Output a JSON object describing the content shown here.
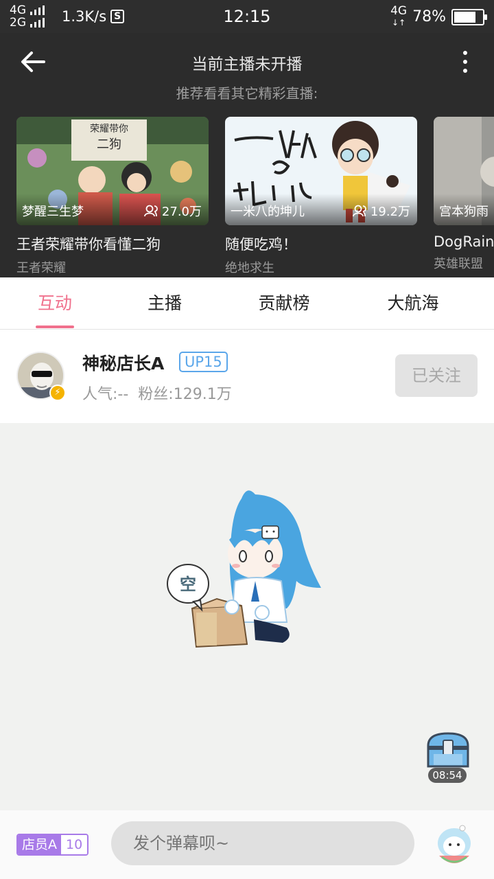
{
  "status_bar": {
    "net1": "4G",
    "net2": "2G",
    "speed": "1.3K/s",
    "s_glyph": "S",
    "time": "12:15",
    "net_right": "4G",
    "battery": "78%",
    "battery_level": 0.78
  },
  "header": {
    "title": "当前主播未开播",
    "subtitle": "推荐看看其它精彩直播:"
  },
  "recommend": [
    {
      "anchor": "梦醒三生梦",
      "viewers": "27.0万",
      "title": "王者荣耀带你看懂二狗",
      "category": "王者荣耀"
    },
    {
      "anchor": "一米八的坤儿",
      "viewers": "19.2万",
      "title": "随便吃鸡！",
      "category": "绝地求生"
    },
    {
      "anchor": "宫本狗雨",
      "viewers": "",
      "title": "DogRain",
      "category": "英雄联盟"
    }
  ],
  "tabs": [
    "互动",
    "主播",
    "贡献榜",
    "大航海"
  ],
  "anchor_info": {
    "name": "神秘店长A",
    "level": "UP15",
    "popularity": "人气:--",
    "fans": "粉丝:129.1万",
    "follow_label": "已关注"
  },
  "empty_state": {
    "bubble_text": "空",
    "chest_timer": "08:54"
  },
  "bottom": {
    "medal_name": "店员A",
    "medal_level": "10",
    "danmaku_placeholder": "发个弹幕呗~"
  },
  "colors": {
    "accent_pink": "#f0708c",
    "up_blue": "#5aa6ea",
    "medal_purple": "#a87ae8",
    "header_bg": "#2c2c2c"
  }
}
